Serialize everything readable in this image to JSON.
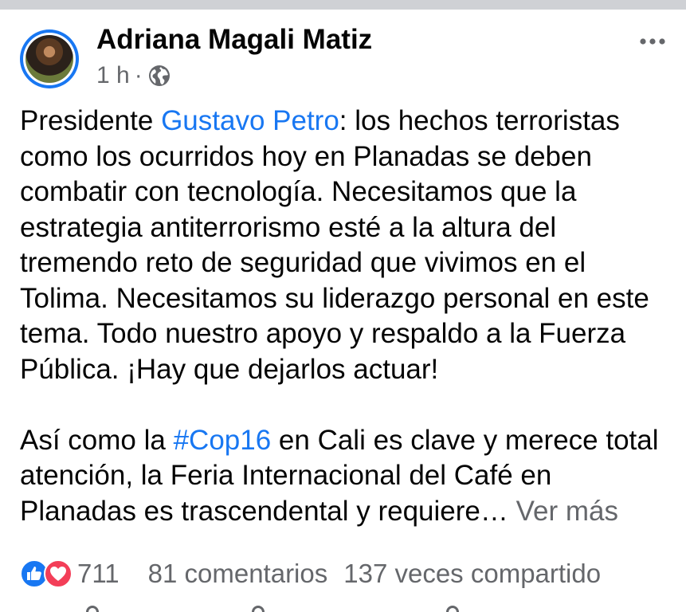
{
  "post": {
    "author": "Adriana Magali Matiz",
    "time": "1 h",
    "separator": "·",
    "privacy_icon": "globe-icon",
    "more_icon": "more-options-icon",
    "text": {
      "p1_before": "Presidente ",
      "p1_mention": "Gustavo Petro",
      "p1_after": ": los hechos terroristas como los ocurridos hoy en Planadas se deben combatir con tecnología. Necesitamos que la estrategia antiterrorismo esté a la altura del tremendo reto de seguridad que vivimos en el Tolima. Necesitamos su liderazgo personal en este tema. Todo nuestro apoyo y respaldo a la Fuerza Pública. ¡Hay que dejarlos actuar!",
      "p2_before": "Así como la ",
      "p2_hashtag": "#Cop16",
      "p2_after": " en Cali es clave y merece total atención, la Feria Internacional del Café en Planadas es trascendental y requiere… ",
      "see_more": "Ver más"
    },
    "stats": {
      "reaction_icons": [
        "like-icon",
        "love-icon"
      ],
      "reactions_count": "711",
      "comments": "81 comentarios",
      "shares": "137 veces compartido"
    },
    "colors": {
      "link": "#1877f2",
      "secondary_text": "#65676b",
      "like": "#1877f2",
      "love": "#f33e58"
    }
  }
}
